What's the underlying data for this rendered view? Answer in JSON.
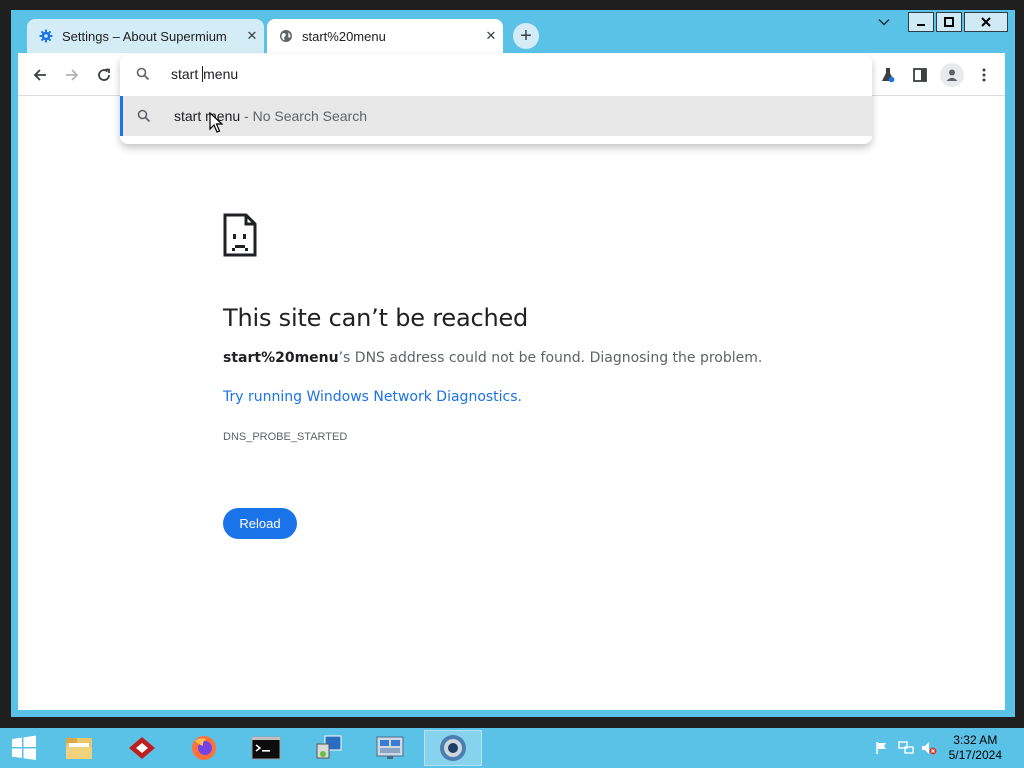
{
  "browser": {
    "tabs": [
      {
        "title": "Settings – About Supermium",
        "icon": "gear-icon",
        "active": false
      },
      {
        "title": "start%20menu",
        "icon": "globe-icon",
        "active": true
      }
    ],
    "new_tab_label": "+",
    "address": {
      "typed_before_cursor": "start ",
      "typed_after_cursor": "menu"
    },
    "suggestion": {
      "query": "start menu",
      "suffix": " - No Search Search"
    }
  },
  "error_page": {
    "title": "This site can’t be reached",
    "host": "start%20menu",
    "description": "’s DNS address could not be found. Diagnosing the problem.",
    "link": "Try running Windows Network Diagnostics.",
    "code": "DNS_PROBE_STARTED",
    "reload_label": "Reload"
  },
  "taskbar": {
    "apps": [
      "start-button",
      "file-explorer",
      "filezilla",
      "firefox",
      "command-prompt",
      "control-panel",
      "server-manager",
      "supermium"
    ],
    "clock_time": "3:32 AM",
    "clock_date": "5/17/2024"
  },
  "colors": {
    "accent": "#1a73e8",
    "frame": "#5bc2e7",
    "tab_inactive": "#d4ecf6",
    "taskbar": "#5bc2e7"
  }
}
